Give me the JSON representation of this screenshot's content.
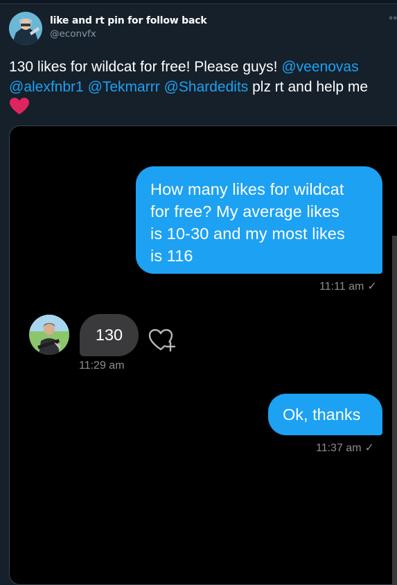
{
  "tweet": {
    "author_name": "like and rt pin for follow back",
    "author_handle": "@econvfx",
    "text_line1_plain": "130 likes for wildcat for free! Please guys! ",
    "text_line1_mention": "@veenovas",
    "text_line2_mention_1": "@alexfnbr1",
    "text_line2_mention_2": "@Tekmarrr",
    "text_line2_mention_3": "@Shardedits",
    "text_line2_plain": " plz rt and help me",
    "emoji_icon": "red-heart-icon"
  },
  "conversation": {
    "messages": [
      {
        "direction": "outgoing",
        "lines": [
          "How many likes for wildcat",
          "for free? My average likes",
          "is 10-30 and my most likes",
          "is 116"
        ],
        "time": "11:11 am",
        "read_icon": "checkmark-icon"
      },
      {
        "direction": "incoming",
        "text": "130",
        "time": "11:29 am",
        "reaction_icon": "heart-plus-icon"
      },
      {
        "direction": "outgoing",
        "text": "Ok, thanks",
        "time": "11:37 am",
        "read_icon": "checkmark-icon"
      }
    ]
  },
  "colors": {
    "background": "#15202b",
    "accent": "#1da1f2",
    "muted_text": "#8899a6",
    "outgoing_bubble": "#1da1f2",
    "incoming_bubble": "#3a3a3c",
    "timestamp": "#8e8e93",
    "media_background": "#000000",
    "heart": "#e0245e"
  }
}
